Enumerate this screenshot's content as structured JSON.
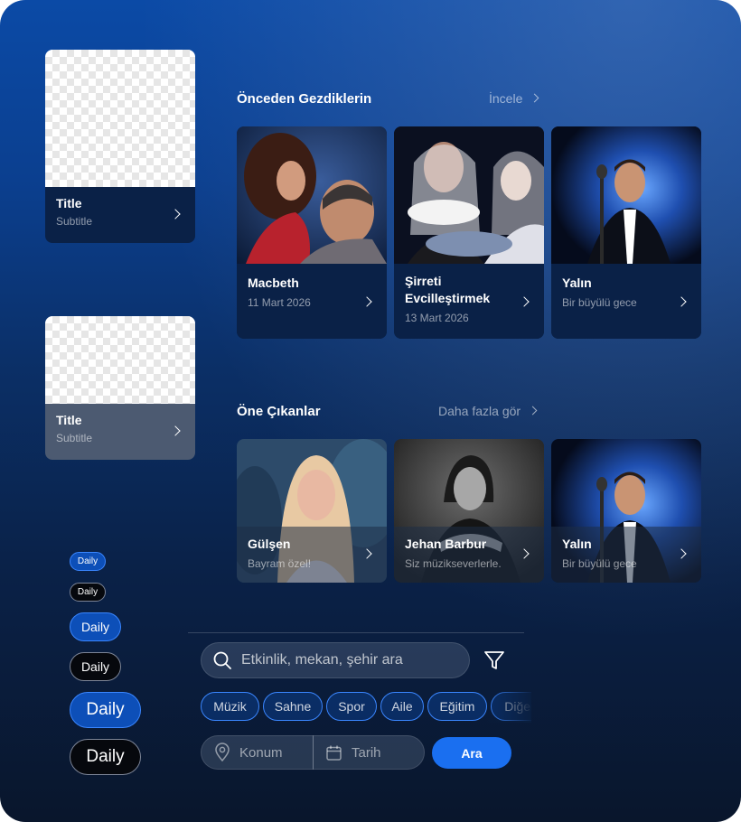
{
  "colors": {
    "background_top": "#0b4aa6",
    "background_bottom": "#09162c",
    "accent": "#1a6ff0",
    "chip_border": "#3a86ff",
    "card_info": "#0a2147"
  },
  "component_cards": [
    {
      "title": "Title",
      "subtitle": "Subtitle",
      "icon": "chevron-right-icon",
      "variant": "dark"
    },
    {
      "title": "Title",
      "subtitle": "Subtitle",
      "icon": "chevron-right-icon",
      "variant": "translucent"
    }
  ],
  "daily_pills": [
    {
      "label": "Daily",
      "variant": "blue",
      "size": "small"
    },
    {
      "label": "Daily",
      "variant": "dark",
      "size": "small"
    },
    {
      "label": "Daily",
      "variant": "blue",
      "size": "medium"
    },
    {
      "label": "Daily",
      "variant": "dark",
      "size": "medium"
    },
    {
      "label": "Daily",
      "variant": "blue",
      "size": "large"
    },
    {
      "label": "Daily",
      "variant": "dark",
      "size": "large"
    }
  ],
  "previously_visited": {
    "title": "Önceden Gezdiklerin",
    "link": "İncele",
    "items": [
      {
        "title": "Macbeth",
        "subtitle": "11 Mart 2026"
      },
      {
        "title": "Şirreti Evcilleştirmek",
        "subtitle": "13 Mart 2026"
      },
      {
        "title": "Yalın",
        "subtitle": "Bir büyülü gece"
      }
    ]
  },
  "featured": {
    "title": "Öne Çıkanlar",
    "link": "Daha fazla gör",
    "items": [
      {
        "title": "Gülşen",
        "subtitle": "Bayram özel!"
      },
      {
        "title": "Jehan Barbur",
        "subtitle": "Siz müzikseverlerle."
      },
      {
        "title": "Yalın",
        "subtitle": "Bir büyülü gece"
      }
    ]
  },
  "search": {
    "placeholder": "Etkinlik, mekan, şehir ara",
    "icon": "search-icon",
    "filter_icon": "filter-icon"
  },
  "categories": [
    "Müzik",
    "Sahne",
    "Spor",
    "Aile",
    "Eğitim",
    "Diğer"
  ],
  "location": {
    "placeholder": "Konum",
    "icon": "location-pin-icon"
  },
  "date": {
    "placeholder": "Tarih",
    "icon": "calendar-icon"
  },
  "submit_label": "Ara"
}
